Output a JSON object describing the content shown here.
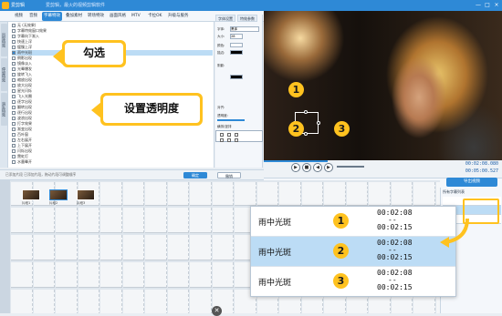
{
  "titlebar": {
    "app": "爱剪辑",
    "subtitle": "爱剪辑，最火的视频剪辑软件",
    "btn_min": "—",
    "btn_max": "□",
    "btn_close": "×"
  },
  "tabs": [
    "视频",
    "音频",
    "字幕特效",
    "叠加素材",
    "转场特效",
    "画面风格",
    "MTV",
    "卡拉OK",
    "升级与服务"
  ],
  "active_tab_index": 2,
  "left_tools": [
    "出现特效",
    "停留特效",
    "消失特效"
  ],
  "effect_list": {
    "items": [
      "无 (无效果)",
      "字幕向下渐入",
      "快速上浮",
      "缓慢上浮",
      "雨中光斑",
      "倒影出现",
      "镜像淡入",
      "光晕爆发",
      "旋转飞入",
      "缩放出现",
      "放大出现",
      "星光闪烁",
      "飞入光圈",
      "逐字出现",
      "翻转出现",
      "逐行出现",
      "波浪出现",
      "打字效果",
      "渐变出现",
      "百叶窗",
      "左右展开",
      "上下展开",
      "闪烁出现",
      "霓虹灯",
      "水墨晕开",
      "弹跳出现"
    ],
    "selected_index": 4,
    "top_row": "字幕特效窗口效果"
  },
  "props_panel": {
    "tabs": [
      "字体设置",
      "特效参数"
    ],
    "rows": [
      "字体:",
      "大小:",
      "颜色:",
      "描边:",
      "阴影:",
      "透明度:",
      "排列:",
      "对齐:"
    ],
    "font_value": "黑体",
    "size_value": "28",
    "opacity_label": "透明度:",
    "bottom_label": "横排/竖排"
  },
  "preview": {
    "description_hidden": true
  },
  "player": {
    "time_current": "00:02:08.080",
    "time_total": "00:05:00.527"
  },
  "subtitle_btn": "导出视频",
  "timeline": {
    "hint": "已添加片段  已添加片段，拖动片段可调整顺序",
    "btn_confirm": "确定",
    "btn_cancel": "撤销",
    "clips": [
      "片段1",
      "片段2",
      "片段3"
    ]
  },
  "rightpanel": {
    "title": "所有字幕列表",
    "rows": [
      "",
      "",
      ""
    ],
    "selected_index": 1
  },
  "zoom": {
    "rows": [
      {
        "name": "雨中光斑",
        "num": "1",
        "t_start": "00:02:08",
        "dash": "--",
        "t_end": "00:02:15"
      },
      {
        "name": "雨中光斑",
        "num": "2",
        "t_start": "00:02:08",
        "dash": "--",
        "t_end": "00:02:15"
      },
      {
        "name": "雨中光斑",
        "num": "3",
        "t_start": "00:02:08",
        "dash": "--",
        "t_end": "00:02:15"
      }
    ],
    "selected_index": 1
  },
  "callouts": {
    "check": "勾选",
    "opacity": "设置透明度"
  },
  "markers": [
    "1",
    "2",
    "3"
  ],
  "colors": {
    "accent": "#2e89d6",
    "callout": "#ffc21f",
    "selected_row": "#bcdcf5"
  }
}
